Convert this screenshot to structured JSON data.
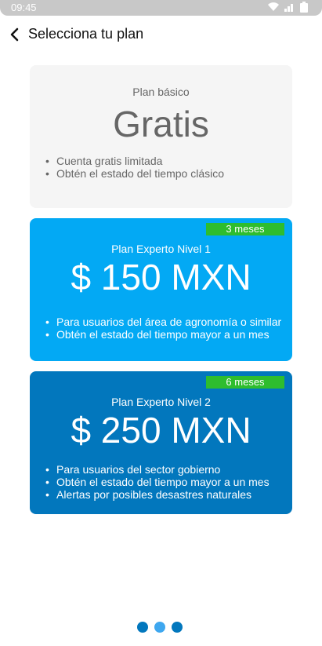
{
  "status_bar": {
    "time": "09:45"
  },
  "header": {
    "title": "Selecciona tu plan"
  },
  "plans": [
    {
      "name": "Plan básico",
      "price": "Gratis",
      "features": [
        "Cuenta gratis limitada",
        "Obtén el estado del tiempo clásico"
      ],
      "color": "#f5f5f5"
    },
    {
      "name": "Plan Experto Nivel 1",
      "price": "$ 150 MXN",
      "badge": "3 meses",
      "features": [
        "Para usuarios del área de agronomía o similar",
        "Obtén el estado del tiempo mayor a un mes"
      ],
      "color": "#03a9f4"
    },
    {
      "name": "Plan Experto Nivel 2",
      "price": "$ 250 MXN",
      "badge": "6 meses",
      "features": [
        "Para usuarios del sector gobierno",
        "Obtén el estado del tiempo mayor a un mes",
        "Alertas por posibles desastres naturales"
      ],
      "color": "#0277bd"
    }
  ],
  "pagination": {
    "pages": 3,
    "active_index": 1
  },
  "colors": {
    "badge": "#2ebd2e",
    "dot": "#0277bd",
    "dot_active": "#3ea7ef"
  }
}
